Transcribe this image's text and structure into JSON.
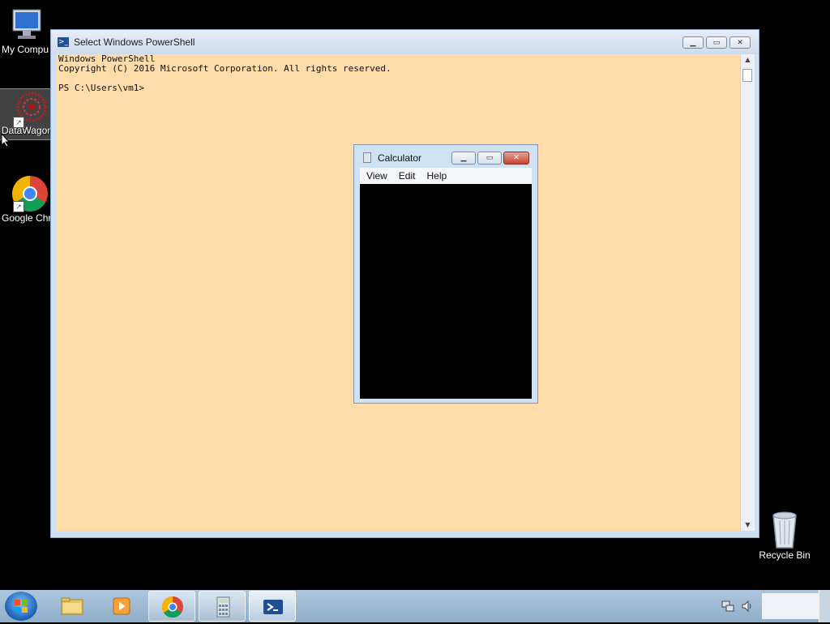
{
  "desktop": {
    "icons": [
      {
        "label": "My Compu"
      },
      {
        "label": "DataWagon...."
      },
      {
        "label": "Google Chr"
      }
    ],
    "recycle_bin": {
      "label": "Recycle Bin"
    }
  },
  "powershell": {
    "title": "Select Windows PowerShell",
    "console_lines": [
      "Windows PowerShell",
      "Copyright (C) 2016 Microsoft Corporation. All rights reserved.",
      "",
      "PS C:\\Users\\vm1>"
    ]
  },
  "calculator": {
    "title": "Calculator",
    "menu": [
      "View",
      "Edit",
      "Help"
    ]
  },
  "taskbar": {
    "items": [
      "start-button",
      "file-explorer",
      "media-player",
      "google-chrome",
      "calculator",
      "windows-powershell"
    ],
    "active": "windows-powershell"
  }
}
